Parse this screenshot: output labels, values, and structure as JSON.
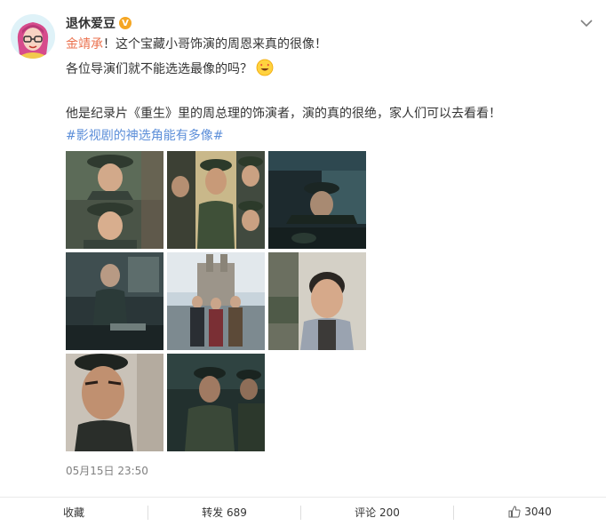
{
  "post": {
    "author": "退休爱豆",
    "verified_badge": "V",
    "mention": "金靖承",
    "line1_rest": "！这个宝藏小哥饰演的周恩来真的很像！",
    "line2": "各位导演们就不能选选最像的吗？",
    "emoji": "smiling-face-with-heart-eyes-icon",
    "line3": "他是纪录片《重生》里的周总理的饰演者，演的真的很绝，家人们可以去看看！",
    "topic": "#影视剧的神选角能有多像#",
    "timestamp": "05月15日 23:50"
  },
  "images": [
    {
      "name": "photo-1"
    },
    {
      "name": "photo-2"
    },
    {
      "name": "photo-3"
    },
    {
      "name": "photo-4"
    },
    {
      "name": "photo-5"
    },
    {
      "name": "photo-6"
    },
    {
      "name": "photo-7"
    },
    {
      "name": "photo-8"
    }
  ],
  "footer": {
    "favorite_label": "收藏",
    "repost_label": "转发 689",
    "comment_label": "评论 200",
    "like_count": "3040"
  },
  "colors": {
    "mention": "#eb7350",
    "topic": "#5d8fd9",
    "badge": "#f5a623",
    "text": "#333333",
    "muted": "#808080"
  }
}
